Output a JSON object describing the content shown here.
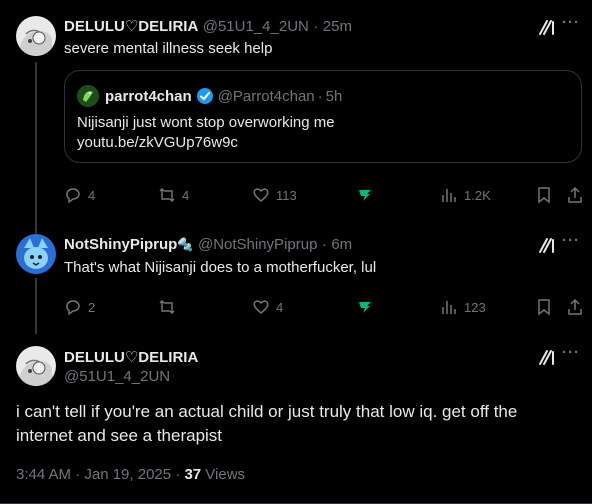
{
  "tweet1": {
    "display_name": "DELULU♡DELIRIA",
    "handle": "@51U1_4_2UN",
    "time": "25m",
    "text": "severe mental illness seek help",
    "quote": {
      "display_name": "parrot4chan",
      "handle": "@Parrot4chan",
      "time": "5h",
      "text": "Nijisanji just wont stop overworking me",
      "link": "youtu.be/zkVGUp76w9c"
    },
    "actions": {
      "replies": "4",
      "reposts": "4",
      "likes": "113",
      "views": "1.2K"
    }
  },
  "tweet2": {
    "display_name": "NotShinyPiprup",
    "name_emoji": "🔩",
    "handle": "@NotShinyPiprup",
    "time": "6m",
    "text": "That's what Nijisanji does to a motherfucker, lul",
    "actions": {
      "replies": "2",
      "reposts": "",
      "likes": "4",
      "views": "123"
    }
  },
  "tweet3": {
    "display_name": "DELULU♡DELIRIA",
    "handle": "@51U1_4_2UN",
    "text": "i can't tell if you're an actual child or just truly that low iq. get off the internet and see a therapist",
    "timestamp": "3:44 AM · Jan 19, 2025 · ",
    "views_count": "37",
    "views_label": "Views"
  },
  "separators": {
    "dot": "·",
    "more": "···"
  },
  "colors": {
    "background": "#000000",
    "text": "#e7e9ea",
    "muted": "#71767b",
    "verified": "#1d9bf0",
    "border": "#2f3336",
    "accent_green": "#00ba7c"
  },
  "icons": [
    "grok-icon",
    "more-icon",
    "reply-icon",
    "repost-icon",
    "like-icon",
    "analytics-icon",
    "bookmark-icon",
    "share-icon",
    "verified-badge-icon"
  ]
}
